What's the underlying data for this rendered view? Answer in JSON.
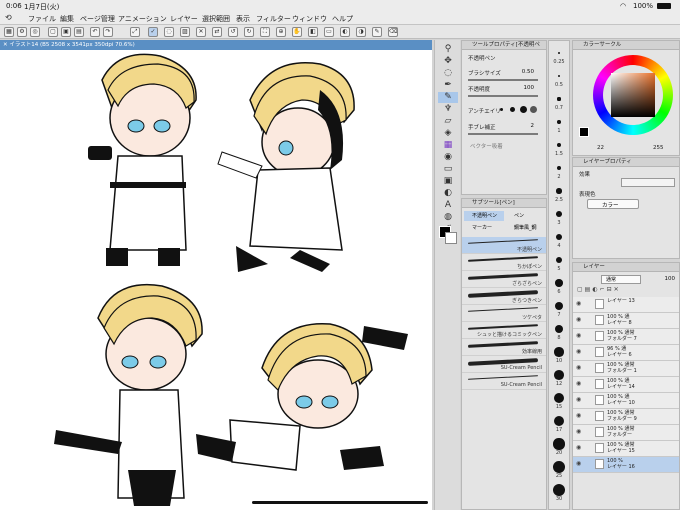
{
  "status_bar": {
    "time": "0:06",
    "date": "1月7日(火)",
    "battery": "100%"
  },
  "menu": {
    "logo": "app-logo-icon",
    "items": [
      "ファイル",
      "編集",
      "ページ管理",
      "アニメーション",
      "レイヤー",
      "選択範囲",
      "表示",
      "フィルター",
      "ウィンドウ",
      "ヘルプ"
    ]
  },
  "document": {
    "tab_title": "イラスト14 (B5 2508 x 3541px 350dpi 70.6%)"
  },
  "tool_property": {
    "title": "ツールプロパティ[不透明ペ",
    "brush_name": "不透明ペン",
    "brush_size_label": "ブラシサイズ",
    "brush_size_value": "0.50",
    "opacity_label": "不透明度",
    "opacity_value": "100",
    "antialias_label": "アンチエイリ",
    "stabilize_label": "手ブレ補正",
    "stabilize_value": "2",
    "vector_label": "ベクター吸着"
  },
  "brush_size_values": [
    "0.25",
    "0.5",
    "0.7",
    "1",
    "1.5",
    "2",
    "2.5",
    "3",
    "4",
    "5",
    "6",
    "7",
    "8",
    "10",
    "12",
    "15",
    "17",
    "20",
    "25",
    "30"
  ],
  "subtool": {
    "title": "サブツール[ペン]",
    "tabs": [
      "不透明ペン",
      "ペン",
      "マーカー",
      "鋼筆風_鋼"
    ],
    "brushes": [
      "不透明ペン",
      "ちかぽペン",
      "ざらざらペン",
      "ぎらつきペン",
      "ツケペタ",
      "シュッと描けるコミックペン",
      "効率線用",
      "SU-Cream Pencil",
      "SU-Cream Pencil"
    ]
  },
  "color_circle": {
    "title": "カラーサークル",
    "hue": "22",
    "value": "255"
  },
  "layer_property": {
    "title": "レイヤープロパティ",
    "effect_label": "効果",
    "color_label": "表現色",
    "color_value": "カラー"
  },
  "layer_panel": {
    "title": "レイヤー",
    "blend_mode": "通常",
    "opacity": "100",
    "layers": [
      {
        "line1": "レイヤー 13",
        "line2": ""
      },
      {
        "line1": "100 % 通",
        "line2": "レイヤー 8"
      },
      {
        "line1": "100 % 通常",
        "line2": "フォルダー 7"
      },
      {
        "line1": "96 % 通",
        "line2": "レイヤー 6"
      },
      {
        "line1": "100 % 通常",
        "line2": "フォルダー 1"
      },
      {
        "line1": "100 % 通",
        "line2": "レイヤー 14"
      },
      {
        "line1": "100 % 通",
        "line2": "レイヤー 10"
      },
      {
        "line1": "100 % 通常",
        "line2": "フォルダー 9"
      },
      {
        "line1": "100 % 通常",
        "line2": "フォルダー"
      },
      {
        "line1": "100 % 通常",
        "line2": "レイヤー 15"
      },
      {
        "line1": "100 %",
        "line2": "レイヤー 16"
      }
    ]
  },
  "colors": {
    "accent": "#5a8fc4",
    "hair": "#f2d88a",
    "eye": "#7ccbe8",
    "main_color": "#000000"
  }
}
